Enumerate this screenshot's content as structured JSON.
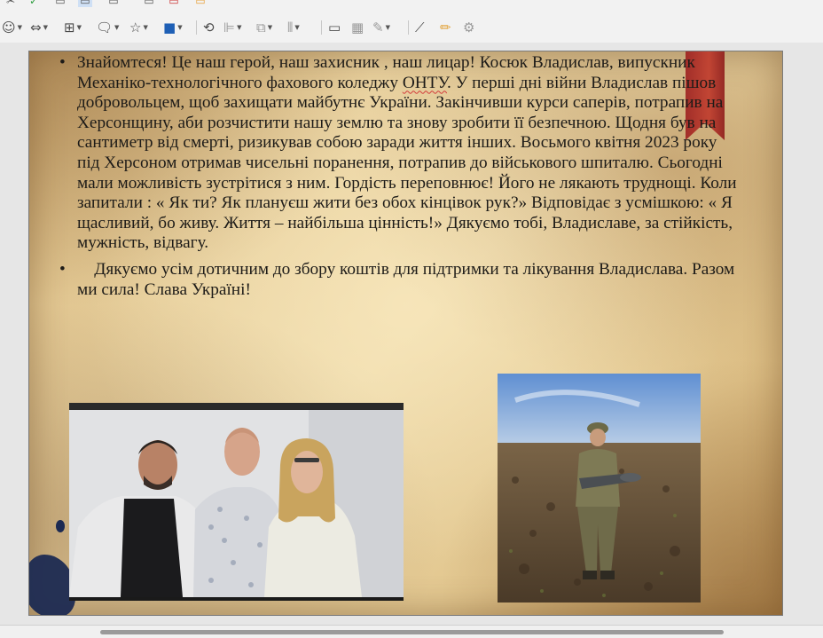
{
  "toolbar": {
    "items": [
      {
        "icon": "smiley-icon",
        "glyph": "☺"
      },
      {
        "icon": "double-arrow-icon",
        "glyph": "⇔"
      },
      {
        "icon": "flowchart-icon",
        "glyph": "⊞"
      },
      {
        "icon": "callout-icon",
        "glyph": "◻"
      },
      {
        "icon": "star-icon",
        "glyph": "☆"
      },
      {
        "icon": "3d-shape-icon",
        "glyph": "■"
      }
    ]
  },
  "slide": {
    "paragraphs": [
      {
        "id": "p1",
        "before": "Знайомтеся! Це наш герой, наш захисник , наш лицар! Косюк Владислав, випускник Механіко-технологічного фахового коледжу ",
        "underlined": "ОНТУ",
        "after": ". У перші дні війни Владислав пішов добровольцем, щоб захищати  майбутнє України. Закінчивши  курси саперів, потрапив на  Херсонщину, аби розчистити нашу землю та знову зробити її безпечною. Щодня був на сантиметр від смерті, ризикував собою заради  життя інших.  Восьмого квітня 2023 року  під Херсоном отримав чисельні поранення, потрапив до військового шпиталю. Сьогодні мали  можливість зустрітися з ним. Гордість переповнює! Його не лякають труднощі. Коли запитали : « Як ти? Як плануєш жити без обох кінцівок рук?» Відповідає з усмішкою: « Я щасливий, бо живу. Життя – найбільша цінність!» Дякуємо тобі, Владиславе, за стійкість, мужність, відвагу."
      },
      {
        "id": "p2",
        "text": "    Дякуємо усім дотичним до збору коштів для підтримки та лікування Владислава. Разом ми сила! Слава Україні!"
      }
    ],
    "images": [
      {
        "name": "photo-hospital-group"
      },
      {
        "name": "photo-soldier-field"
      }
    ]
  },
  "colors": {
    "parchment": "#e7cf9c",
    "bookmark": "#b22c24",
    "ink": "#1c2a52",
    "spellcheck": "#d23a3a"
  }
}
